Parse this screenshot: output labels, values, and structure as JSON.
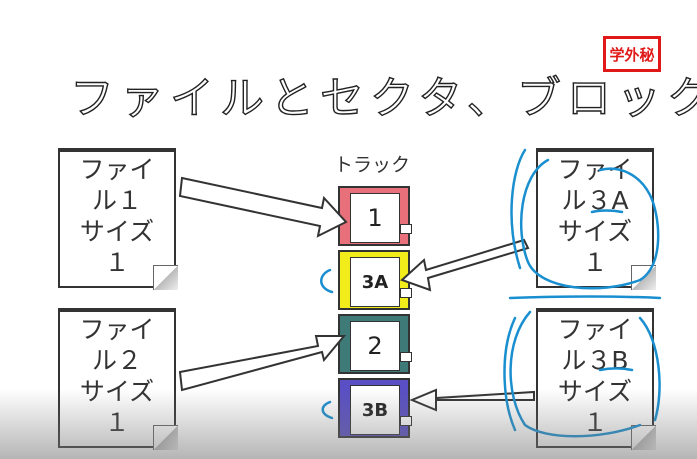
{
  "title": "ファイルとセクタ、ブロック",
  "stamp": "学外秘",
  "track_label": "トラック",
  "files_left": [
    {
      "lines": [
        "ファイ",
        "ル１",
        "サイズ",
        "１"
      ]
    },
    {
      "lines": [
        "ファイ",
        "ル２",
        "サイズ",
        "１"
      ]
    }
  ],
  "files_right": [
    {
      "lines": [
        "ファイ",
        "ル３A",
        "サイズ",
        "１"
      ]
    },
    {
      "lines": [
        "ファイ",
        "ル３B",
        "サイズ",
        "１"
      ]
    }
  ],
  "blocks": [
    {
      "label": "1",
      "color": "#e8707a"
    },
    {
      "label": "3A",
      "color": "#f2ec1a"
    },
    {
      "label": "2",
      "color": "#3d7a78"
    },
    {
      "label": "3B",
      "color": "#5a4fc4"
    }
  ],
  "colors": {
    "annotation": "#1a8fd0",
    "stamp": "#e01818"
  }
}
